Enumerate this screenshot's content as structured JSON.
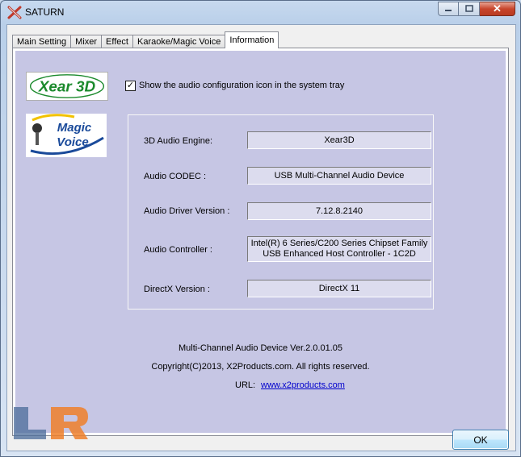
{
  "window": {
    "title": "SATURN"
  },
  "tabs": [
    {
      "label": "Main Setting"
    },
    {
      "label": "Mixer"
    },
    {
      "label": "Effect"
    },
    {
      "label": "Karaoke/Magic Voice"
    },
    {
      "label": "Information"
    }
  ],
  "active_tab": "Information",
  "logos": {
    "xear": "Xear 3D",
    "magic_line1": "Magic",
    "magic_line2": "Voice"
  },
  "tray_option": {
    "checked": true,
    "check_glyph": "✓",
    "label": "Show the audio configuration icon in the system tray"
  },
  "info": {
    "rows": [
      {
        "label": "3D Audio Engine:",
        "value": "Xear3D"
      },
      {
        "label": "Audio CODEC :",
        "value": "USB Multi-Channel Audio Device"
      },
      {
        "label": "Audio Driver Version :",
        "value": "7.12.8.2140"
      },
      {
        "label": "Audio Controller :",
        "value_line1": "Intel(R) 6 Series/C200 Series Chipset Family",
        "value_line2": "USB Enhanced Host Controller - 1C2D"
      },
      {
        "label": "DirectX Version :",
        "value": "DirectX 11"
      }
    ]
  },
  "footer": {
    "product": "Multi-Channel Audio Device Ver.2.0.01.05",
    "copyright": "Copyright(C)2013, X2Products.com. All rights reserved.",
    "url_label": "URL:",
    "url": "www.x2products.com"
  },
  "buttons": {
    "ok": "OK",
    "close_glyph": "✕"
  },
  "colors": {
    "panel_background": "#c6c6e4",
    "value_background": "#dcdcee",
    "link": "#0000cc",
    "xear_green": "#1b8a2c",
    "magic_blue": "#1a4a9a"
  },
  "icons": {
    "app": "saturn-x-icon",
    "watermark": "legit-reviews-logo"
  }
}
